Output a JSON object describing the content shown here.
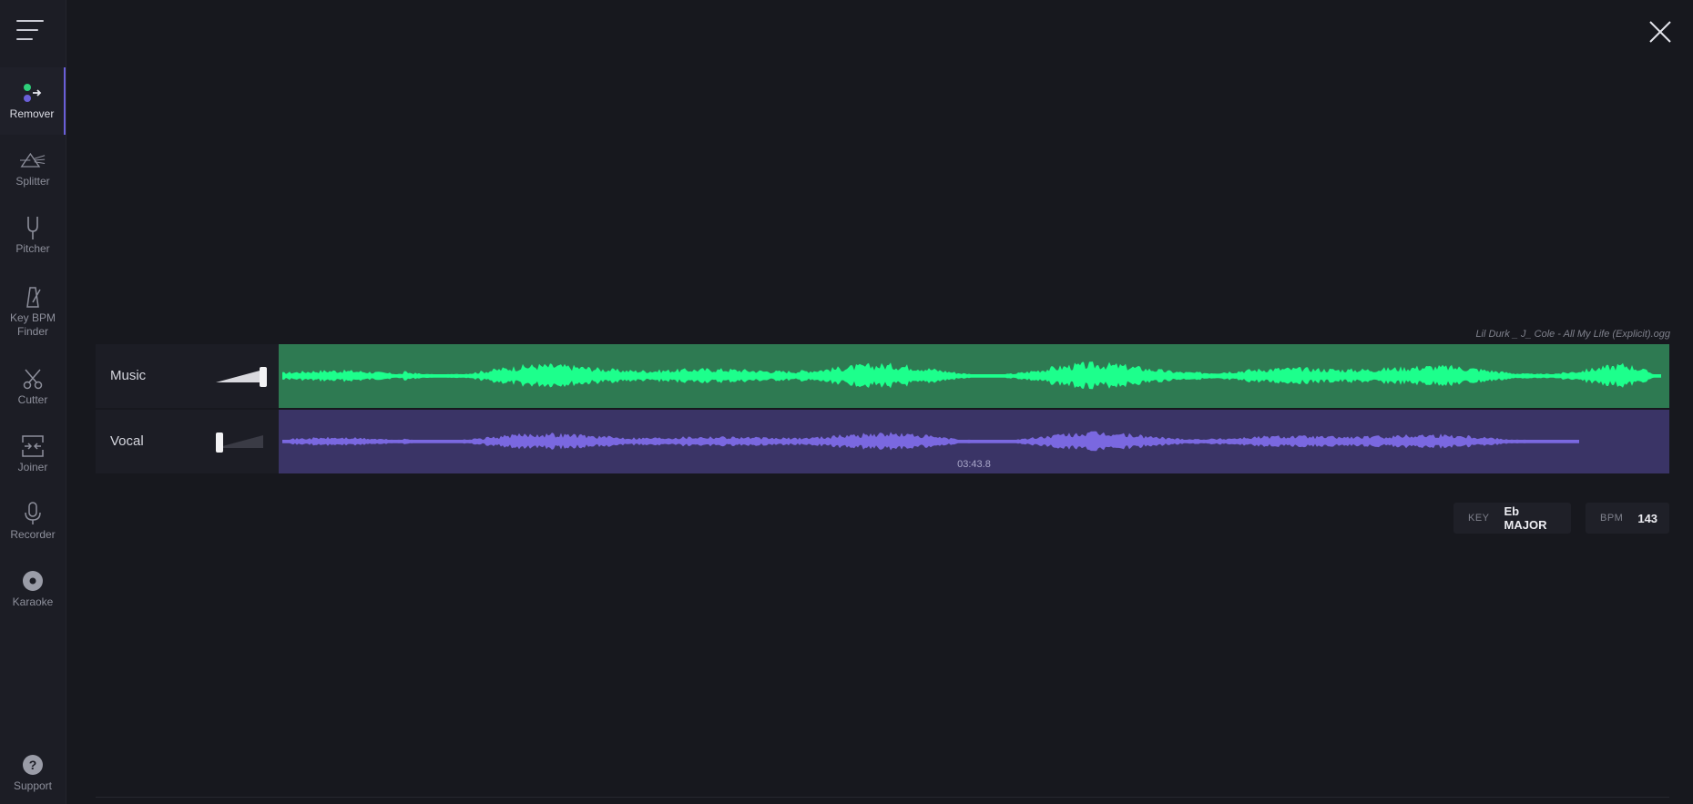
{
  "sidebar": {
    "items": [
      {
        "id": "remover",
        "label": "Remover",
        "icon": "remover-icon",
        "active": true
      },
      {
        "id": "splitter",
        "label": "Splitter",
        "icon": "prism-icon"
      },
      {
        "id": "pitcher",
        "label": "Pitcher",
        "icon": "tuning-fork-icon"
      },
      {
        "id": "key-bpm",
        "label": "Key BPM Finder",
        "icon": "metronome-icon"
      },
      {
        "id": "cutter",
        "label": "Cutter",
        "icon": "scissors-icon"
      },
      {
        "id": "joiner",
        "label": "Joiner",
        "icon": "joiner-icon"
      },
      {
        "id": "recorder",
        "label": "Recorder",
        "icon": "microphone-icon"
      },
      {
        "id": "karaoke",
        "label": "Karaoke",
        "icon": "disc-icon"
      }
    ],
    "support": {
      "label": "Support",
      "icon": "help-icon"
    }
  },
  "file": {
    "name": "Lil Durk _ J_ Cole - All My Life (Explicit).ogg"
  },
  "tracks": {
    "music": {
      "label": "Music",
      "color": "#1dff8c",
      "background": "#2e7a52",
      "volume": 1.0
    },
    "vocal": {
      "label": "Vocal",
      "color": "#7a68e0",
      "background": "#3a3466",
      "volume": 0.0,
      "duration": "03:43.8"
    }
  },
  "analysis": {
    "key_label": "KEY",
    "key_value": "Eb MAJOR",
    "bpm_label": "BPM",
    "bpm_value": "143"
  },
  "colors": {
    "accent": "#6a5fd8",
    "background": "#17181e",
    "sidebar": "#1c1d25"
  }
}
